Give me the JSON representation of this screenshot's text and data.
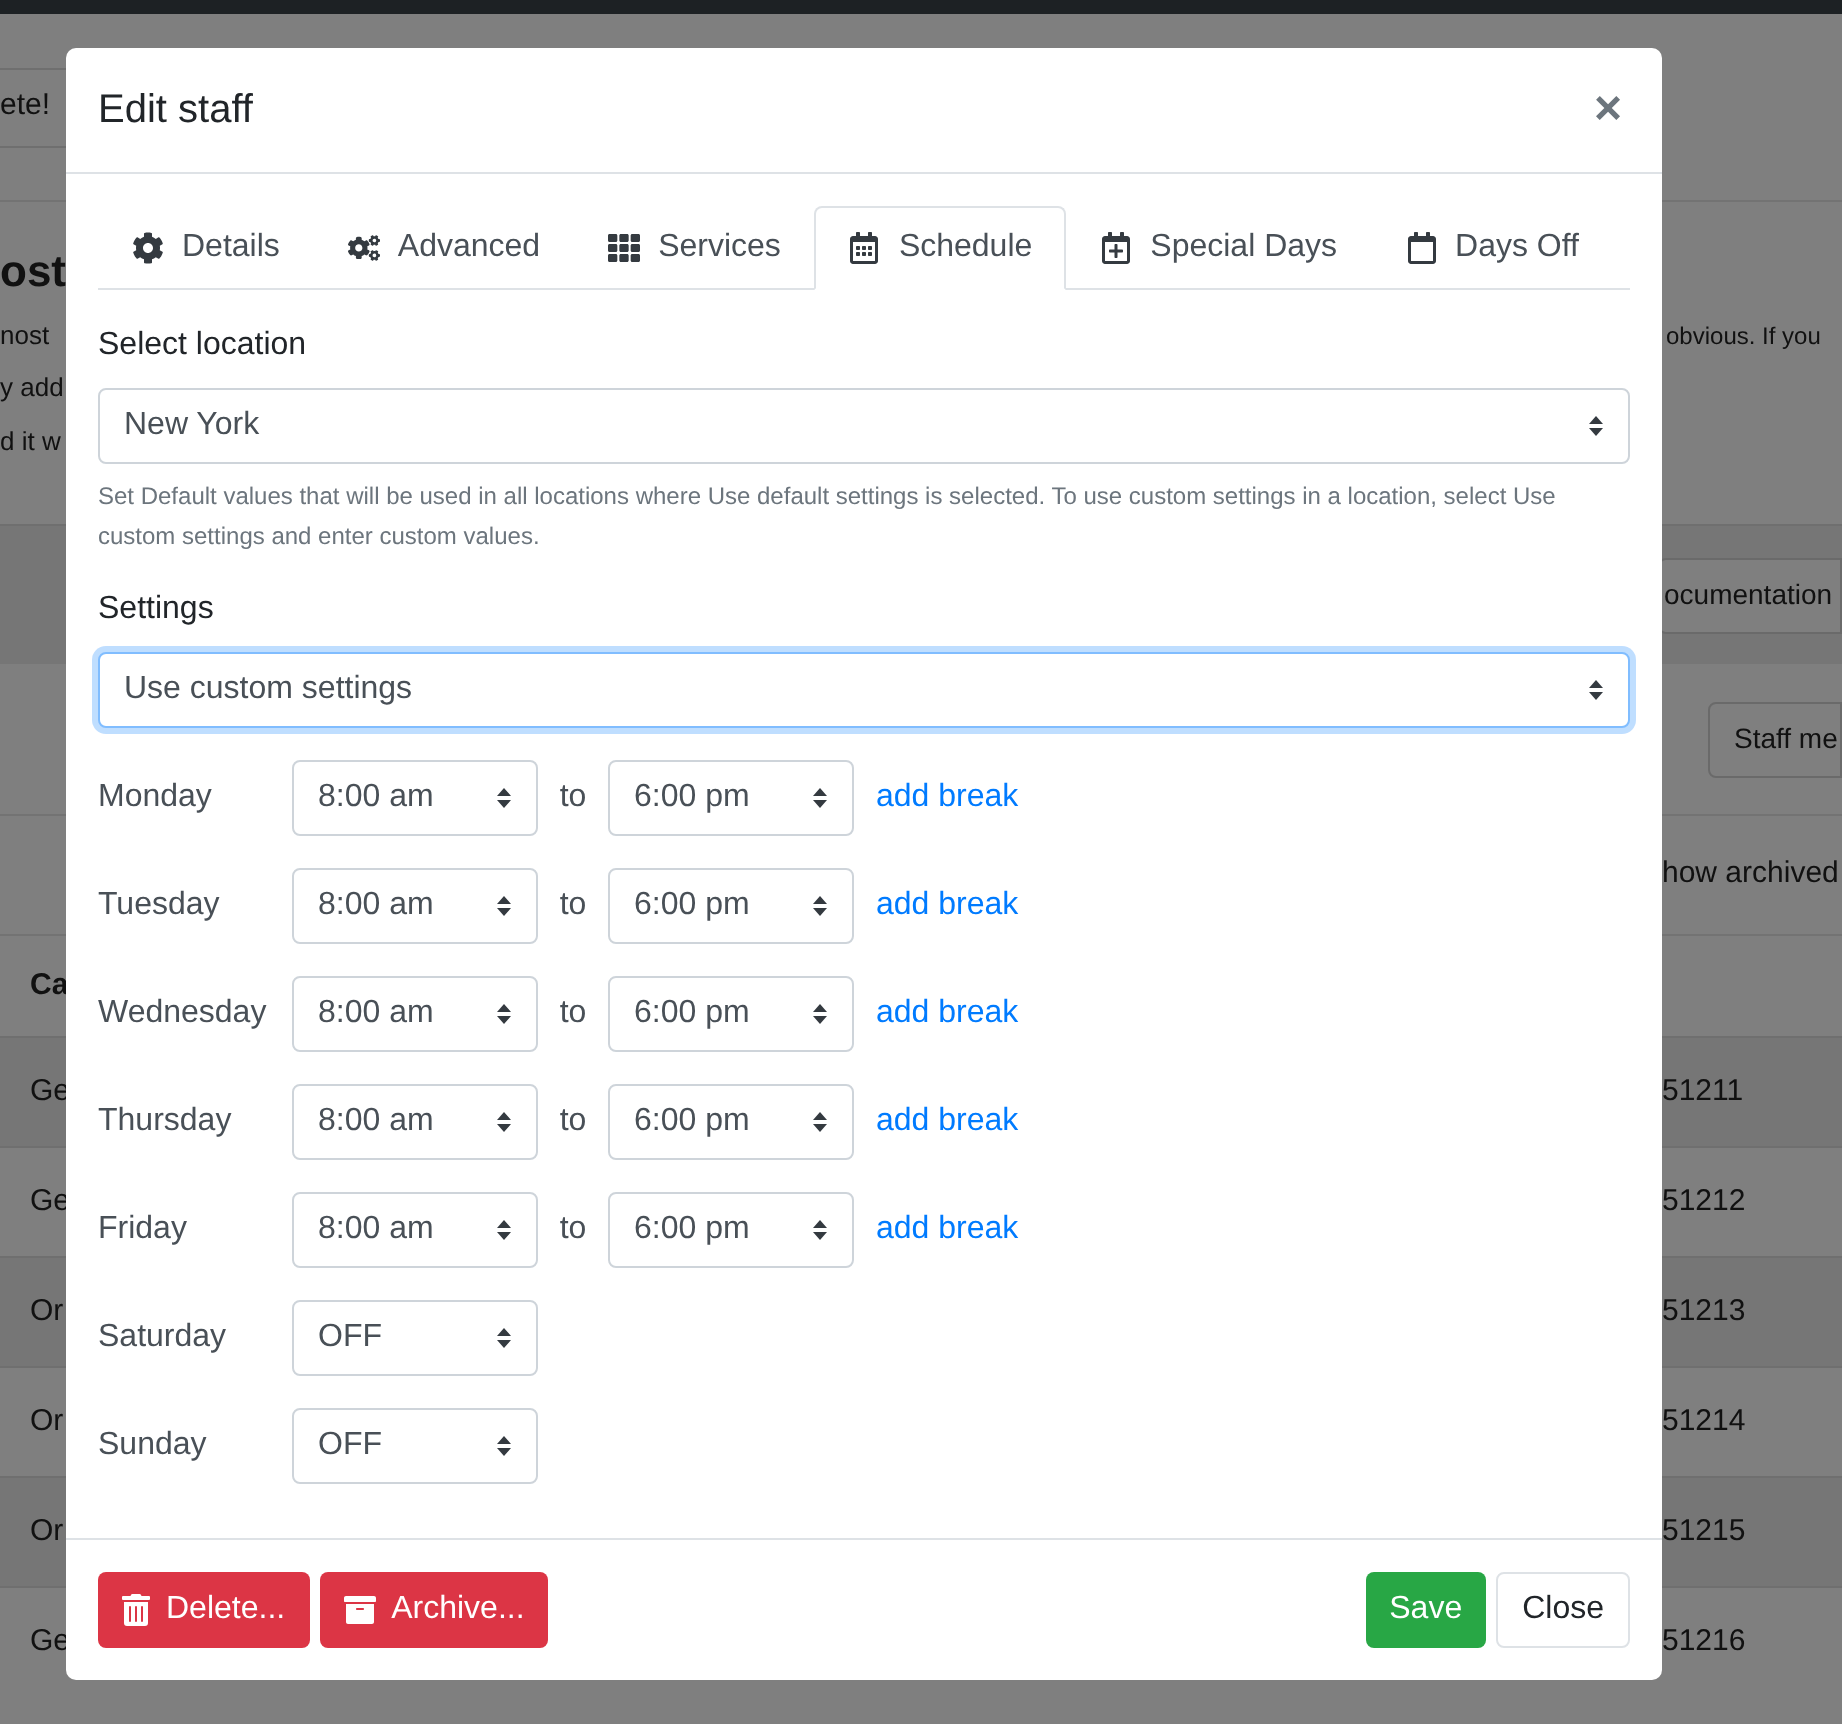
{
  "background": {
    "alert_text": "ete!",
    "heading": "ost",
    "lines": [
      "nost",
      "y add",
      "d it w"
    ],
    "right_text": "obvious. If you",
    "documentation_button": "ocumentation",
    "staff_button": "Staff me",
    "show_archived": "how archived",
    "table_header": "Ca",
    "rows": [
      {
        "column_1": "Ge",
        "column_2": "51211"
      },
      {
        "column_1": "Ge",
        "column_2": "51212"
      },
      {
        "column_1": "Or",
        "column_2": "51213"
      },
      {
        "column_1": "Or",
        "column_2": "51214"
      },
      {
        "column_1": "Or",
        "column_2": "51215"
      },
      {
        "column_1": "Ge",
        "column_2": "51216"
      }
    ]
  },
  "modal": {
    "title": "Edit staff",
    "close": "×",
    "tabs": [
      {
        "label": "Details",
        "selected": false
      },
      {
        "label": "Advanced",
        "selected": false
      },
      {
        "label": "Services",
        "selected": false
      },
      {
        "label": "Schedule",
        "selected": true
      },
      {
        "label": "Special Days",
        "selected": false
      },
      {
        "label": "Days Off",
        "selected": false
      }
    ],
    "location_label": "Select location",
    "location_value": "New York",
    "help_text": "Set Default values that will be used in all locations where Use default settings is selected. To use custom settings in a location, select Use custom settings and enter custom values.",
    "settings_label": "Settings",
    "settings_value": "Use custom settings",
    "days": [
      {
        "day": "Monday",
        "kind": "hours",
        "start": "8:00 am",
        "to": "to",
        "end": "6:00 pm",
        "action": "add break"
      },
      {
        "day": "Tuesday",
        "kind": "hours",
        "start": "8:00 am",
        "to": "to",
        "end": "6:00 pm",
        "action": "add break"
      },
      {
        "day": "Wednesday",
        "kind": "hours",
        "start": "8:00 am",
        "to": "to",
        "end": "6:00 pm",
        "action": "add break"
      },
      {
        "day": "Thursday",
        "kind": "hours",
        "start": "8:00 am",
        "to": "to",
        "end": "6:00 pm",
        "action": "add break"
      },
      {
        "day": "Friday",
        "kind": "hours",
        "start": "8:00 am",
        "to": "to",
        "end": "6:00 pm",
        "action": "add break"
      },
      {
        "day": "Saturday",
        "kind": "off",
        "start": "OFF"
      },
      {
        "day": "Sunday",
        "kind": "off",
        "start": "OFF"
      }
    ],
    "footer": {
      "delete": "Delete...",
      "archive": "Archive...",
      "save": "Save",
      "close": "Close"
    }
  }
}
